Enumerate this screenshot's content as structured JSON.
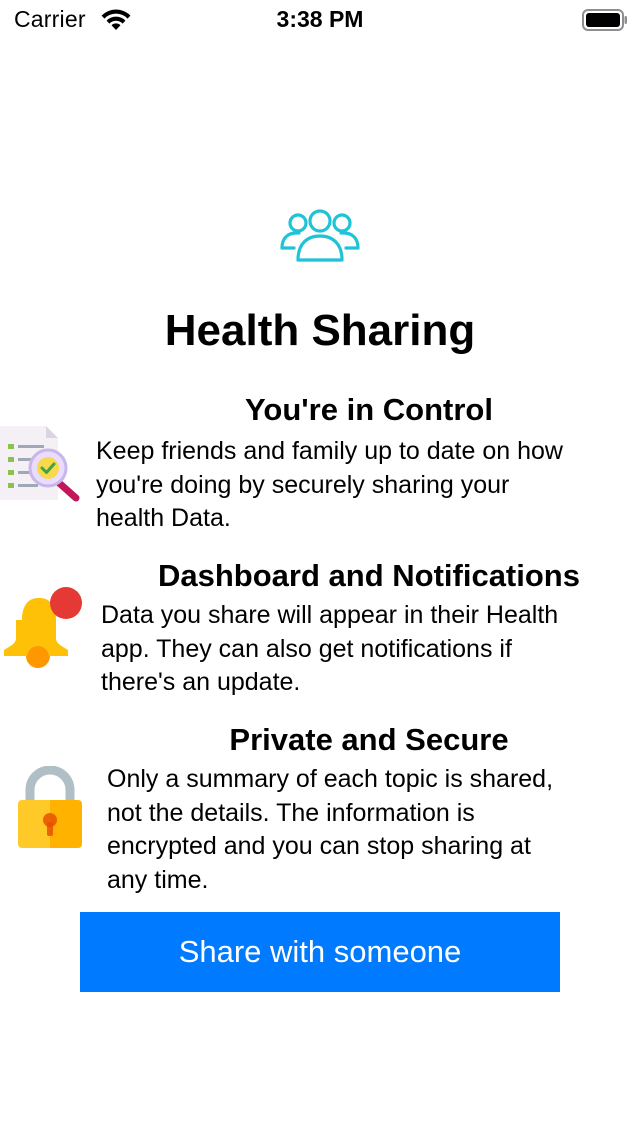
{
  "status_bar": {
    "carrier": "Carrier",
    "time": "3:38 PM"
  },
  "main": {
    "title": "Health Sharing",
    "features": [
      {
        "title": "You're in Control",
        "lines": [
          "Keep friends and family up to date on how",
          "you're doing by securely sharing your",
          "health Data."
        ],
        "icon": "document-search-icon"
      },
      {
        "title": "Dashboard and Notifications",
        "lines": [
          "Data you share will appear in their Health",
          "app. They can also get notifications if",
          "there's an update."
        ],
        "icon": "bell-notification-icon"
      },
      {
        "title": "Private and Secure",
        "lines": [
          "Only a summary of each topic is shared,",
          "not the details. The information is",
          "encrypted and you can stop sharing at",
          "any time."
        ],
        "icon": "padlock-icon"
      }
    ],
    "share_button_label": "Share with someone"
  },
  "colors": {
    "accent_blue": "#007aff",
    "hero_icon_teal": "#1ec4d6",
    "bell_yellow": "#ffc107",
    "badge_red": "#e53935"
  }
}
